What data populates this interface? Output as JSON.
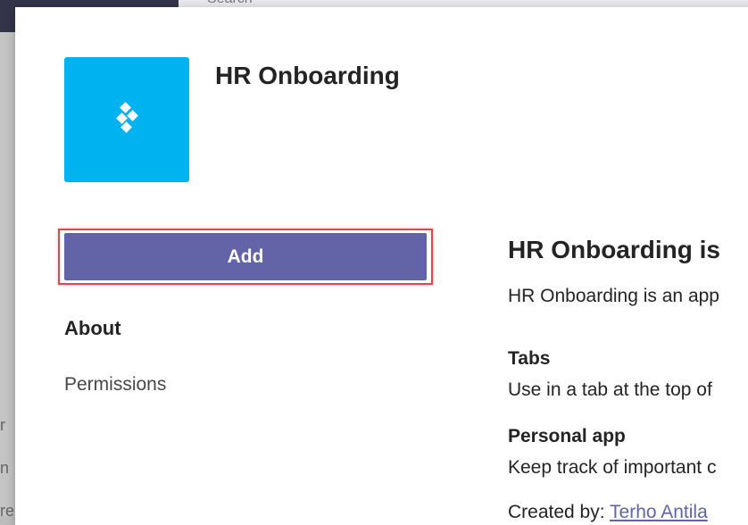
{
  "background": {
    "search_text": "Search",
    "side_letters": [
      "r",
      "n",
      "re"
    ]
  },
  "app": {
    "name": "HR Onboarding",
    "icon": "diamond-cluster-icon",
    "icon_color": "#00b2ef"
  },
  "actions": {
    "add_label": "Add",
    "accent_color": "#6264a7",
    "highlight_color": "#e0474c"
  },
  "left_nav": {
    "about_label": "About",
    "permissions_label": "Permissions"
  },
  "details": {
    "heading": "HR Onboarding is",
    "description": "HR Onboarding is an app",
    "sections": [
      {
        "title": "Tabs",
        "text": "Use in a tab at the top of"
      },
      {
        "title": "Personal app",
        "text": "Keep track of important c"
      }
    ],
    "created_by_label": "Created by:",
    "created_by_name": "Terho Antila"
  }
}
